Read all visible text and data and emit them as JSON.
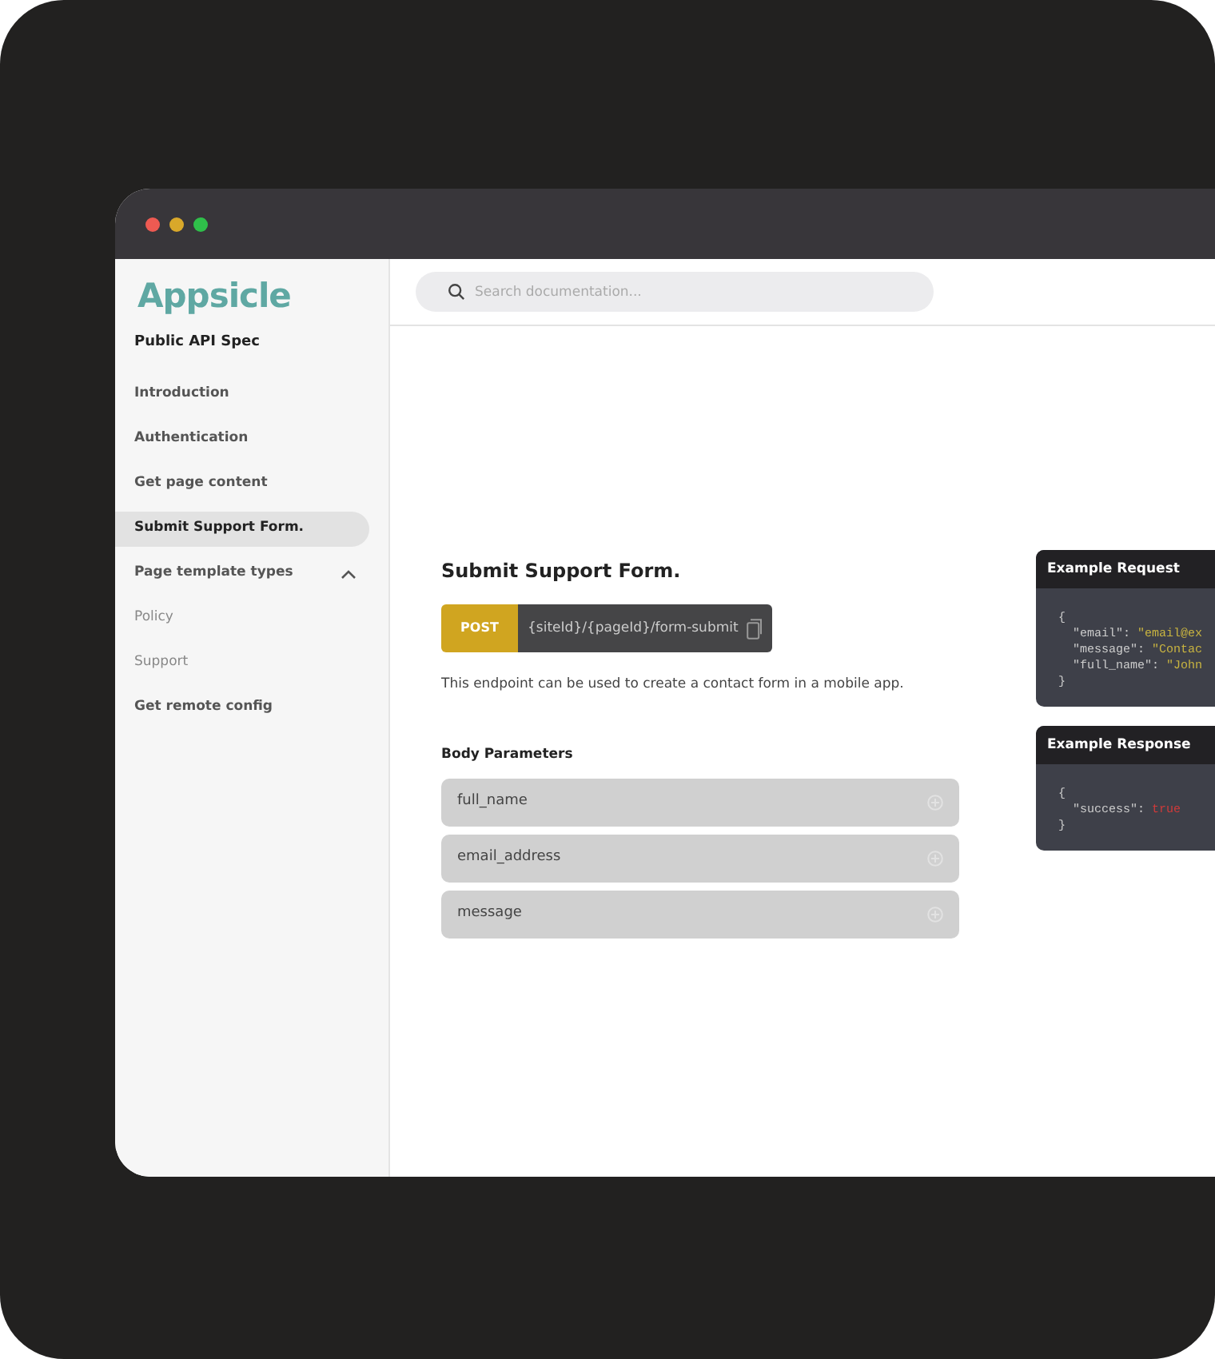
{
  "window": {
    "controls": [
      {
        "color": "#ee5a52"
      },
      {
        "color": "#d9a82a"
      },
      {
        "color": "#2fbf4a"
      }
    ]
  },
  "sidebar": {
    "logo": "Appsicle",
    "subtitle": "Public API Spec",
    "items": [
      {
        "label": "Introduction",
        "kind": "item",
        "selected": false
      },
      {
        "label": "Authentication",
        "kind": "item",
        "selected": false
      },
      {
        "label": "Get page content",
        "kind": "item",
        "selected": false
      },
      {
        "label": "Submit Support Form.",
        "kind": "item",
        "selected": true
      },
      {
        "label": "Page template types",
        "kind": "group",
        "selected": false,
        "expanded": true,
        "children": [
          {
            "label": "Policy",
            "kind": "subitem",
            "selected": false
          },
          {
            "label": "Support",
            "kind": "subitem",
            "selected": false
          }
        ]
      },
      {
        "label": "Get remote config",
        "kind": "item",
        "selected": false
      }
    ]
  },
  "search": {
    "placeholder": "Search documentation..."
  },
  "endpoint": {
    "title": "Submit Support Form.",
    "method": "POST",
    "path": "{siteId}/{pageId}/form-submit",
    "description": "This endpoint can be used to create a contact form in a mobile app.",
    "params_heading": "Body Parameters",
    "params": [
      "full_name",
      "email_address",
      "message"
    ]
  },
  "examples": [
    {
      "title": "Example Request",
      "lines": [
        {
          "kind": "brace",
          "text": "{"
        },
        {
          "kind": "string",
          "key": "\"email\":",
          "value": "\"email@ex"
        },
        {
          "kind": "string",
          "key": "\"message\":",
          "value": "\"Contac"
        },
        {
          "kind": "string",
          "key": "\"full_name\":",
          "value": "\"John"
        },
        {
          "kind": "brace",
          "text": "}"
        }
      ]
    },
    {
      "title": "Example Response",
      "lines": [
        {
          "kind": "brace",
          "text": "{"
        },
        {
          "kind": "boolean",
          "key": "\"success\":",
          "value": "true"
        },
        {
          "kind": "brace",
          "text": "}"
        }
      ]
    }
  ]
}
